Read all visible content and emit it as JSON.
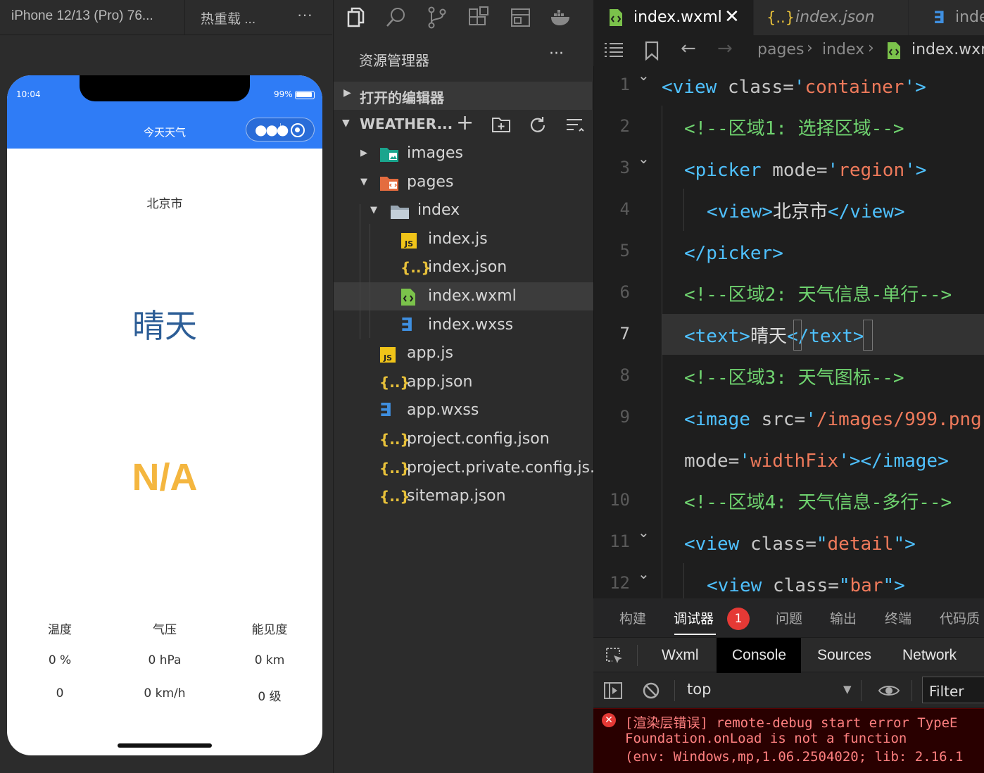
{
  "simulator": {
    "device": "iPhone 12/13 (Pro) 76...",
    "reload": "热重载 ...",
    "more": "···",
    "status": {
      "time": "10:04",
      "battery": "99%"
    },
    "nav_title": "今天天气",
    "city": "北京市",
    "weather": "晴天",
    "temp_big": "N/A",
    "metrics": {
      "headers": [
        "温度",
        "气压",
        "能见度"
      ],
      "row1": [
        "0 %",
        "0 hPa",
        "0 km"
      ],
      "row2": [
        "0",
        "0 km/h",
        "0 级"
      ]
    }
  },
  "explorer": {
    "title": "资源管理器",
    "more": "···",
    "open_editors": "打开的编辑器",
    "project": "WEATHER...",
    "items": [
      {
        "label": "images",
        "kind": "folder-images",
        "depth": 0,
        "arrow": "right"
      },
      {
        "label": "pages",
        "kind": "folder-pages",
        "depth": 0,
        "arrow": "down"
      },
      {
        "label": "index",
        "kind": "folder",
        "depth": 1,
        "arrow": "down"
      },
      {
        "label": "index.js",
        "kind": "js",
        "depth": 2
      },
      {
        "label": "index.json",
        "kind": "json",
        "depth": 2
      },
      {
        "label": "index.wxml",
        "kind": "wxml",
        "depth": 2,
        "selected": true
      },
      {
        "label": "index.wxss",
        "kind": "wxss",
        "depth": 2
      },
      {
        "label": "app.js",
        "kind": "js",
        "depth": 0
      },
      {
        "label": "app.json",
        "kind": "json",
        "depth": 0
      },
      {
        "label": "app.wxss",
        "kind": "wxss",
        "depth": 0
      },
      {
        "label": "project.config.json",
        "kind": "json",
        "depth": 0
      },
      {
        "label": "project.private.config.js...",
        "kind": "json",
        "depth": 0
      },
      {
        "label": "sitemap.json",
        "kind": "json",
        "depth": 0
      }
    ]
  },
  "editor": {
    "tabs": [
      "index.wxml",
      "index.json",
      "inde"
    ],
    "crumb": [
      "pages",
      "index",
      "index.wxn"
    ],
    "line_numbers": [
      "1",
      "2",
      "3",
      "4",
      "5",
      "6",
      "7",
      "8",
      "9",
      "",
      "10",
      "11",
      "12"
    ],
    "active_line": "7",
    "lines": [
      "<view class='container'>",
      "<!--区域1: 选择区域-->",
      "<picker mode='region'>",
      "<view>北京市</view>",
      "</picker>",
      "<!--区域2: 天气信息-单行-->",
      "<text>晴天</text>",
      "<!--区域3: 天气图标-->",
      "<image src='/images/999.png'",
      "mode='widthFix'></image>",
      "<!--区域4: 天气信息-多行-->",
      "<view class=\"detail\">",
      "<view class=\"bar\">"
    ]
  },
  "panel": {
    "tabs": [
      "构建",
      "调试器",
      "问题",
      "输出",
      "终端",
      "代码质"
    ],
    "badge": "1",
    "devtools": [
      "Wxml",
      "Console",
      "Sources",
      "Network"
    ],
    "context": "top",
    "filter": "Filter",
    "error": [
      "[渲染层错误] remote-debug start error TypeE",
      "Foundation.onLoad is not a function",
      "(env: Windows,mp,1.06.2504020; lib: 2.16.1"
    ]
  }
}
